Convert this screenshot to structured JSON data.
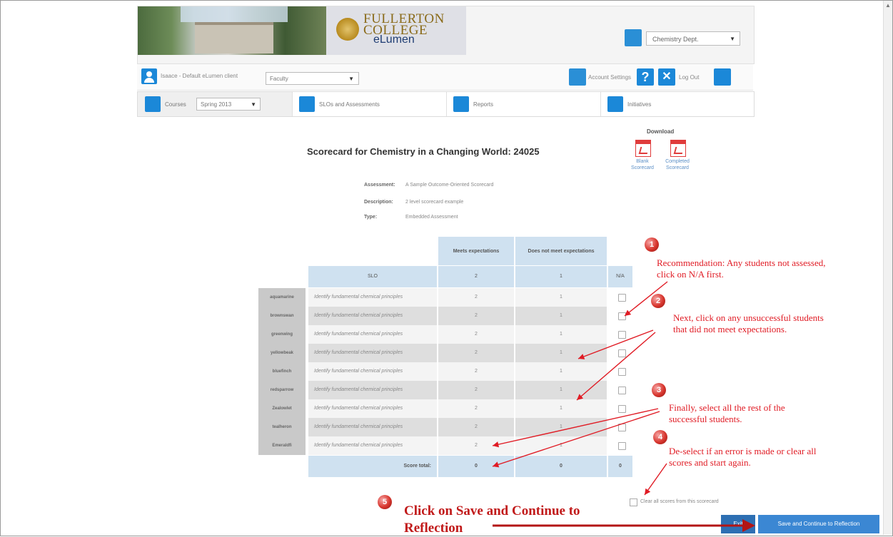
{
  "header": {
    "logo_line1": "FULLERTON",
    "logo_line2": "COLLEGE",
    "logo_sub": "eLumen",
    "department": "Chemistry Dept."
  },
  "userbar": {
    "user_label": "Isaace - Default eLumen client",
    "role": "Faculty",
    "account_settings": "Account Settings",
    "logout": "Log Out"
  },
  "tabs": {
    "courses": "Courses",
    "term": "Spring 2013",
    "slos": "SLOs and Assessments",
    "reports": "Reports",
    "initiatives": "Initiatives"
  },
  "scorecard": {
    "title": "Scorecard for Chemistry in a Changing World: 24025",
    "download_label": "Download",
    "blank_scorecard": "Blank Scorecard",
    "completed_scorecard": "Completed Scorecard",
    "assessment_key": "Assessment:",
    "assessment_val": "A Sample Outcome-Oriented Scorecard",
    "description_key": "Description:",
    "description_val": "2 level scorecard example",
    "type_key": "Type:",
    "type_val": "Embedded Assessment"
  },
  "table": {
    "col_meets": "Meets expectations",
    "col_not_meets": "Does not meet expectations",
    "slo_header": "SLO",
    "meets_score": "2",
    "not_meets_score": "1",
    "na_header": "N/A",
    "rows": [
      {
        "name": "aquamarine",
        "slo": "Identify fundamental chemical principles",
        "c1": "2",
        "c2": "1"
      },
      {
        "name": "brownswan",
        "slo": "Identify fundamental chemical principles",
        "c1": "2",
        "c2": "1"
      },
      {
        "name": "greenwing",
        "slo": "Identify fundamental chemical principles",
        "c1": "2",
        "c2": "1"
      },
      {
        "name": "yellowbeak",
        "slo": "Identify fundamental chemical principles",
        "c1": "2",
        "c2": "1"
      },
      {
        "name": "bluefinch",
        "slo": "Identify fundamental chemical principles",
        "c1": "2",
        "c2": "1"
      },
      {
        "name": "redsparrow",
        "slo": "Identify fundamental chemical principles",
        "c1": "2",
        "c2": "1"
      },
      {
        "name": "Zealowlet",
        "slo": "Identify fundamental chemical principles",
        "c1": "2",
        "c2": "1"
      },
      {
        "name": "tealheron",
        "slo": "Identify fundamental chemical principles",
        "c1": "2",
        "c2": "1"
      },
      {
        "name": "Emeraldfi",
        "slo": "Identify fundamental chemical principles",
        "c1": "2",
        "c2": "1"
      }
    ],
    "total_label": "Score total:",
    "total_meets": "0",
    "total_not_meets": "0",
    "total_na": "0"
  },
  "footer": {
    "clear_label": "Clear all scores from this scorecard",
    "exit_button": "Exit",
    "save_button": "Save and Continue to Reflection"
  },
  "annotations": {
    "n1": "1",
    "n2": "2",
    "n3": "3",
    "n4": "4",
    "n5": "5",
    "note1": "Recommendation:  Any students not assessed, click on N/A first.",
    "note2": "Next, click on any unsuccessful students that did not meet expectations.",
    "note3": "Finally, select all the rest of the successful students.",
    "note4": "De-select if an error is made or clear all scores and start again.",
    "note5": "Click on Save and Continue to Reflection"
  },
  "colors": {
    "accent": "#1b88d8",
    "annotation": "#e01b24",
    "table_header": "#cfe1f0"
  }
}
